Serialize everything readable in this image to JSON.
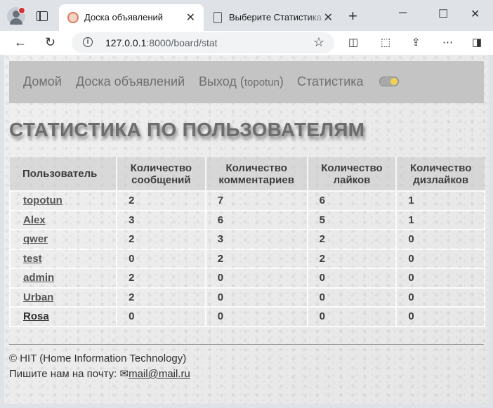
{
  "browser": {
    "tabs": [
      {
        "title": "Доска объявлений",
        "active": true
      },
      {
        "title": "Выберите Статистика для",
        "active": false
      }
    ],
    "new_tab_label": "+",
    "address": {
      "host": "127.0.0.1",
      "path": ":8000/board/stat"
    }
  },
  "nav": {
    "home": "Домой",
    "board": "Доска объявлений",
    "logout": "Выход (",
    "user": "topotun",
    "logout_close": ")",
    "stats": "Статистика"
  },
  "heading": "СТАТИСТИКА ПО ПОЛЬЗОВАТЕЛЯМ",
  "table": {
    "headers": [
      "Пользователь",
      "Количество сообщений",
      "Количество комментариев",
      "Количество лайков",
      "Количество дизлайков"
    ],
    "rows": [
      {
        "user": "topotun",
        "messages": "2",
        "comments": "7",
        "likes": "6",
        "dislikes": "1"
      },
      {
        "user": "Alex",
        "messages": "3",
        "comments": "6",
        "likes": "5",
        "dislikes": "1"
      },
      {
        "user": "qwer",
        "messages": "2",
        "comments": "3",
        "likes": "2",
        "dislikes": "0"
      },
      {
        "user": "test",
        "messages": "0",
        "comments": "2",
        "likes": "2",
        "dislikes": "0"
      },
      {
        "user": "admin",
        "messages": "2",
        "comments": "0",
        "likes": "0",
        "dislikes": "0"
      },
      {
        "user": "Urban",
        "messages": "2",
        "comments": "0",
        "likes": "0",
        "dislikes": "0"
      },
      {
        "user": "Rosa",
        "messages": "0",
        "comments": "0",
        "likes": "0",
        "dislikes": "0"
      }
    ]
  },
  "footer": {
    "copyright": "© HIT (Home Information Technology)",
    "contact_prefix": "Пишите нам на почту: ",
    "email": "mail@mail.ru"
  }
}
